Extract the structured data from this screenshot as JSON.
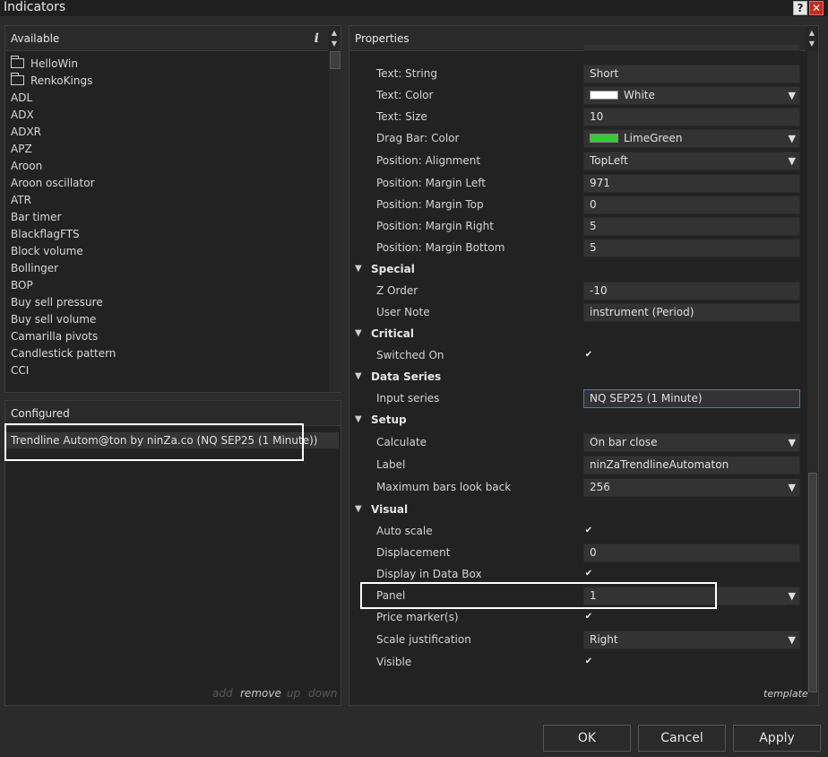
{
  "window": {
    "title": "Indicators",
    "help_glyph": "?",
    "close_glyph": "✕"
  },
  "available": {
    "header": "Available",
    "info_glyph": "i",
    "items": [
      {
        "label": "HelloWin",
        "folder": true
      },
      {
        "label": "RenkoKings",
        "folder": true
      },
      {
        "label": "ADL"
      },
      {
        "label": "ADX"
      },
      {
        "label": "ADXR"
      },
      {
        "label": "APZ"
      },
      {
        "label": "Aroon"
      },
      {
        "label": "Aroon oscillator"
      },
      {
        "label": "ATR"
      },
      {
        "label": "Bar timer"
      },
      {
        "label": "BlackflagFTS"
      },
      {
        "label": "Block volume"
      },
      {
        "label": "Bollinger"
      },
      {
        "label": "BOP"
      },
      {
        "label": "Buy sell pressure"
      },
      {
        "label": "Buy sell volume"
      },
      {
        "label": "Camarilla pivots"
      },
      {
        "label": "Candlestick pattern"
      },
      {
        "label": "CCI"
      }
    ]
  },
  "configured": {
    "header": "Configured",
    "item": "Trendline Autom@ton by ninZa.co (NQ SEP25 (1 Minute))",
    "actions": {
      "add": "add",
      "remove": "remove",
      "up": "up",
      "down": "down"
    }
  },
  "properties": {
    "header": "Properties",
    "rows": [
      {
        "kind": "prop",
        "label": "Text: String",
        "value": "Short"
      },
      {
        "kind": "prop",
        "label": "Text: Color",
        "value": "White",
        "swatch": "#ffffff",
        "dropdown": true
      },
      {
        "kind": "prop",
        "label": "Text: Size",
        "value": "10"
      },
      {
        "kind": "prop",
        "label": "Drag Bar: Color",
        "value": "LimeGreen",
        "swatch": "#32cd32",
        "dropdown": true
      },
      {
        "kind": "prop",
        "label": "Position: Alignment",
        "value": "TopLeft",
        "dropdown": true
      },
      {
        "kind": "prop",
        "label": "Position: Margin Left",
        "value": "971"
      },
      {
        "kind": "prop",
        "label": "Position: Margin Top",
        "value": "0"
      },
      {
        "kind": "prop",
        "label": "Position: Margin Right",
        "value": "5"
      },
      {
        "kind": "prop",
        "label": "Position: Margin Bottom",
        "value": "5"
      },
      {
        "kind": "cat",
        "label": "Special"
      },
      {
        "kind": "prop",
        "label": "Z Order",
        "value": "-10"
      },
      {
        "kind": "prop",
        "label": "User Note",
        "value": "instrument (Period)"
      },
      {
        "kind": "cat",
        "label": "Critical"
      },
      {
        "kind": "check",
        "label": "Switched On",
        "checked": true
      },
      {
        "kind": "cat",
        "label": "Data Series"
      },
      {
        "kind": "prop",
        "label": "Input series",
        "value": "NQ SEP25 (1 Minute)",
        "focused": true
      },
      {
        "kind": "cat",
        "label": "Setup"
      },
      {
        "kind": "prop",
        "label": "Calculate",
        "value": "On bar close",
        "dropdown": true
      },
      {
        "kind": "prop",
        "label": "Label",
        "value": "ninZaTrendlineAutomaton"
      },
      {
        "kind": "prop",
        "label": "Maximum bars look back",
        "value": "256",
        "dropdown": true
      },
      {
        "kind": "cat",
        "label": "Visual"
      },
      {
        "kind": "check",
        "label": "Auto scale",
        "checked": true
      },
      {
        "kind": "prop",
        "label": "Displacement",
        "value": "0"
      },
      {
        "kind": "check",
        "label": "Display in Data Box",
        "checked": true
      },
      {
        "kind": "prop",
        "label": "Panel",
        "value": "1",
        "dropdown": true
      },
      {
        "kind": "check",
        "label": "Price marker(s)",
        "checked": true
      },
      {
        "kind": "prop",
        "label": "Scale justification",
        "value": "Right",
        "dropdown": true
      },
      {
        "kind": "check",
        "label": "Visible",
        "checked": true
      }
    ]
  },
  "footer": {
    "template": "template",
    "ok": "OK",
    "cancel": "Cancel",
    "apply": "Apply"
  },
  "colors": {
    "accent_focus": "#3d7fc2",
    "close_red": "#c42b1c"
  }
}
